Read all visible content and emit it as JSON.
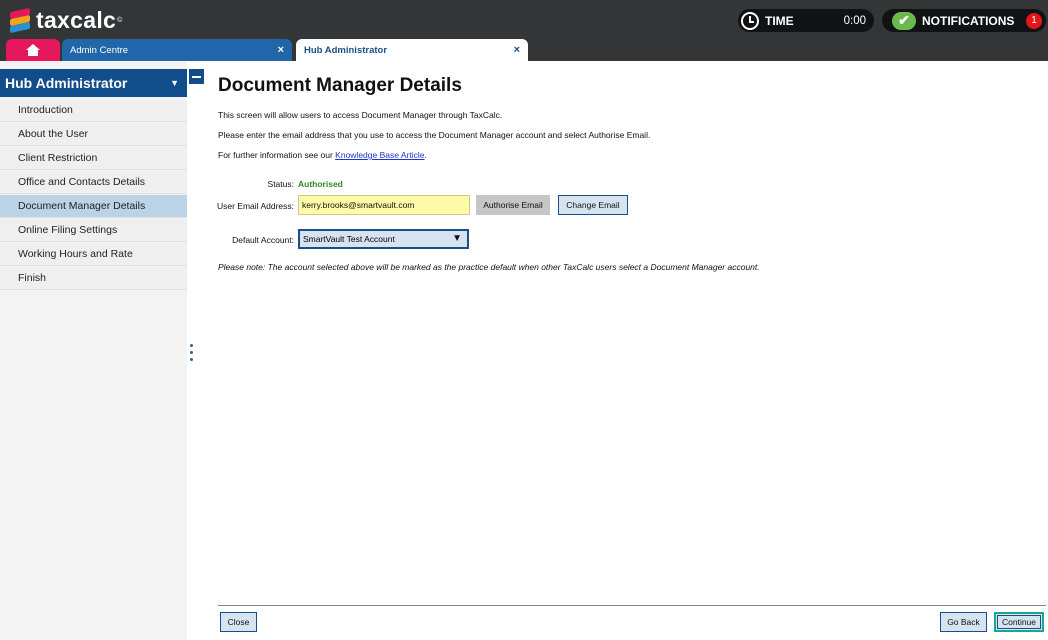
{
  "app": {
    "logo_text": "taxcalc",
    "logo_tm": "©",
    "time_label": "TIME",
    "time_value": "0:00",
    "notifications_label": "NOTIFICATIONS",
    "notifications_count": "1",
    "brand_colors": {
      "top_bar": "#333537",
      "home_tab": "#e5175d",
      "primary": "#114c8b",
      "status_green": "#2e8b1e",
      "highlight_input": "#fffaa8"
    }
  },
  "tabs": [
    {
      "label": "",
      "icon": "home-icon"
    },
    {
      "label": "Admin Centre",
      "close": "×"
    },
    {
      "label": "Hub Administrator",
      "close": "×"
    }
  ],
  "sidebar": {
    "title": "Hub Administrator",
    "arrow": "▼",
    "items": [
      {
        "label": "Introduction"
      },
      {
        "label": "About the User"
      },
      {
        "label": "Client Restriction"
      },
      {
        "label": "Office and Contacts Details"
      },
      {
        "label": "Document Manager Details"
      },
      {
        "label": "Online Filing Settings"
      },
      {
        "label": "Working Hours and Rate"
      },
      {
        "label": "Finish"
      }
    ]
  },
  "main": {
    "title": "Document Manager Details",
    "intro": "This screen will allow users to access Document Manager through TaxCalc.",
    "instructions": "Please enter the email address that you use to access the Document Manager account and select Authorise Email.",
    "info_prefix": "For further information see our ",
    "info_link": "Knowledge Base Article",
    "info_suffix": ".",
    "status_label": "Status:",
    "status_value": "Authorised",
    "email_label": "User Email Address:",
    "email_value": "kerry.brooks@smartvault.com",
    "authorise_button": "Authorise Email",
    "change_button": "Change Email",
    "account_label": "Default Account:",
    "account_value": "SmartVault Test Account",
    "note": "Please note: The account selected above will be marked as the practice default when other TaxCalc users select a Document Manager account."
  },
  "footer": {
    "close_button": "Close",
    "back_button": "Go Back",
    "continue_button": "Continue"
  }
}
